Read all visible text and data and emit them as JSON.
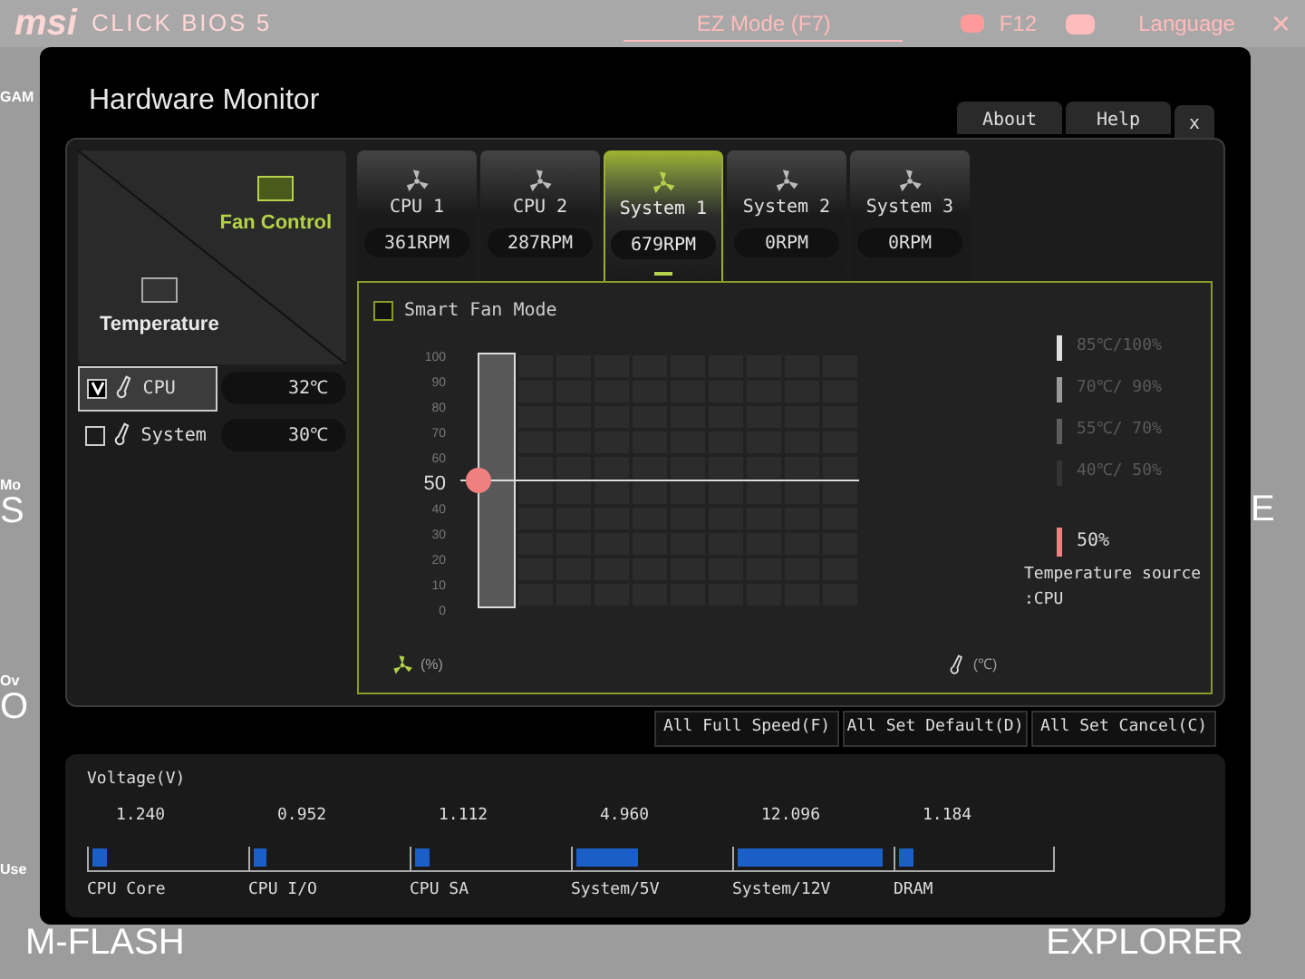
{
  "background": {
    "logo": "msi",
    "product": "CLICK BIOS 5",
    "ez_mode": "EZ Mode (F7)",
    "screenshot_key": "F12",
    "language": "Language",
    "close": "×",
    "left_fragments": [
      "GAM",
      "Mo",
      "S",
      "Ov",
      "O",
      "Use"
    ],
    "right_fragment": "E",
    "bottom_left": "M-FLASH",
    "bottom_right": "EXPLORER"
  },
  "window": {
    "title": "Hardware Monitor",
    "tabs": [
      {
        "label": "About"
      },
      {
        "label": "Help"
      },
      {
        "label": "x"
      }
    ]
  },
  "modes": [
    {
      "label": "Fan Control",
      "selected": true
    },
    {
      "label": "Temperature",
      "selected": false
    }
  ],
  "sensors": [
    {
      "name": "CPU",
      "checked": true,
      "selected": true,
      "reading": "32℃"
    },
    {
      "name": "System",
      "checked": false,
      "selected": false,
      "reading": "30℃"
    }
  ],
  "fans": [
    {
      "name": "CPU 1",
      "speed": "361RPM",
      "selected": false
    },
    {
      "name": "CPU 2",
      "speed": "287RPM",
      "selected": false
    },
    {
      "name": "System 1",
      "speed": "679RPM",
      "selected": true
    },
    {
      "name": "System 2",
      "speed": "0RPM",
      "selected": false
    },
    {
      "name": "System 3",
      "speed": "0RPM",
      "selected": false
    }
  ],
  "smart_fan_mode": {
    "label": "Smart Fan Mode",
    "checked": false
  },
  "fan_curve": {
    "level": 0.5,
    "y_unit": "(%)",
    "x_unit": "(℃)",
    "y_labels": [
      {
        "label": "100",
        "selected": false
      },
      {
        "label": "90",
        "selected": false
      },
      {
        "label": "80",
        "selected": false
      },
      {
        "label": "70",
        "selected": false
      },
      {
        "label": "60",
        "selected": false
      },
      {
        "label": "50",
        "selected": true
      },
      {
        "label": "40",
        "selected": false
      },
      {
        "label": "30",
        "selected": false
      },
      {
        "label": "20",
        "selected": false
      },
      {
        "label": "10",
        "selected": false
      },
      {
        "label": "0",
        "selected": false
      }
    ]
  },
  "legend": [
    {
      "label": "85℃/100%",
      "color": "#e0e0e0"
    },
    {
      "label": "70℃/ 90%",
      "color": "#9a9a9a"
    },
    {
      "label": "55℃/ 70%",
      "color": "#5e5e5e"
    },
    {
      "label": "40℃/ 50%",
      "color": "#343434"
    }
  ],
  "current": {
    "label": "50%",
    "color": "#f08080"
  },
  "temperature_source": [
    "Temperature source",
    ":CPU"
  ],
  "actions": [
    "All Full Speed(F)",
    "All Set Default(D)",
    "All Set Cancel(C)"
  ],
  "voltage": {
    "title": "Voltage(V)",
    "rails": [
      {
        "name": "CPU Core",
        "reading": "1.240",
        "level": 0.1
      },
      {
        "name": "CPU I/O",
        "reading": "0.952",
        "level": 0.08
      },
      {
        "name": "CPU SA",
        "reading": "1.112",
        "level": 0.09
      },
      {
        "name": "System/5V",
        "reading": "4.960",
        "level": 0.4
      },
      {
        "name": "System/12V",
        "reading": "12.096",
        "level": 0.95
      },
      {
        "name": "DRAM",
        "reading": "1.184",
        "level": 0.1
      }
    ]
  }
}
